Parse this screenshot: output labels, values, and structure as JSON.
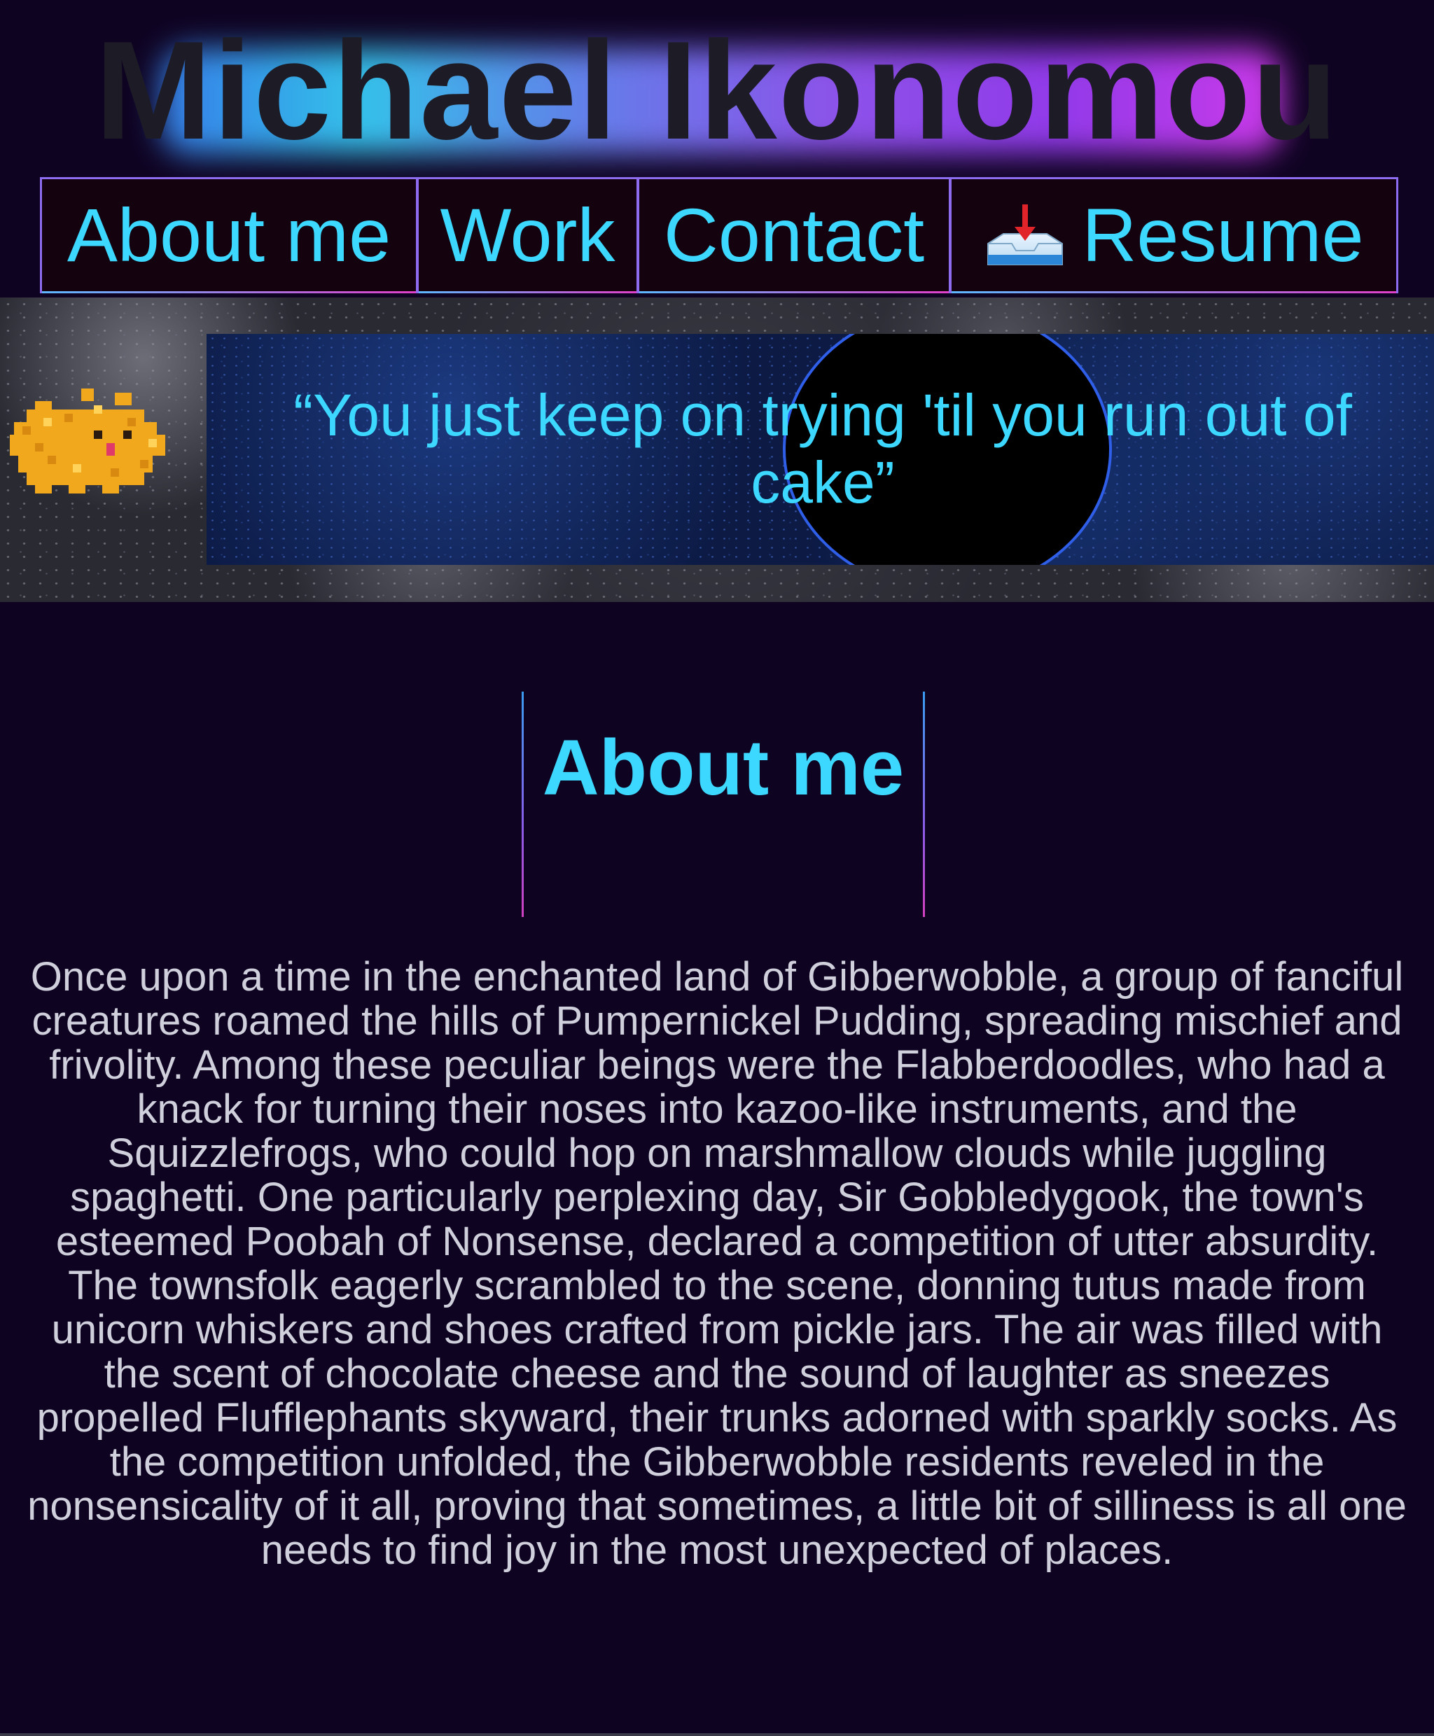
{
  "header": {
    "site_title": "Michael Ikonomou"
  },
  "nav": {
    "items": [
      {
        "label": "About me"
      },
      {
        "label": "Work"
      },
      {
        "label": "Contact"
      },
      {
        "label": "Resume",
        "icon": "download-tray-icon"
      }
    ]
  },
  "banner": {
    "quote": "“You just keep on trying 'til you run out of cake”",
    "sprite": "pixel-pet-icon"
  },
  "about": {
    "heading": "About me",
    "body": "Once upon a time in the enchanted land of Gibberwobble, a group of fanciful creatures roamed the hills of Pumpernickel Pudding, spreading mischief and frivolity. Among these peculiar beings were the Flabberdoodles, who had a knack for turning their noses into kazoo-like instruments, and the Squizzlefrogs, who could hop on marshmallow clouds while juggling spaghetti. One particularly perplexing day, Sir Gobbledygook, the town's esteemed Poobah of Nonsense, declared a competition of utter absurdity. The townsfolk eagerly scrambled to the scene, donning tutus made from unicorn whiskers and shoes crafted from pickle jars. The air was filled with the scent of chocolate cheese and the sound of laughter as sneezes propelled Flufflephants skyward, their trunks adorned with sparkly socks. As the competition unfolded, the Gibberwobble residents reveled in the nonsensicality of it all, proving that sometimes, a little bit of silliness is all one needs to find joy in the most unexpected of places."
  },
  "colors": {
    "background": "#0f0322",
    "accent_cyan": "#3dd8ff",
    "nav_border": "#8e6cf0",
    "title_text": "#1d1c26",
    "body_text": "#cfd0dc"
  }
}
